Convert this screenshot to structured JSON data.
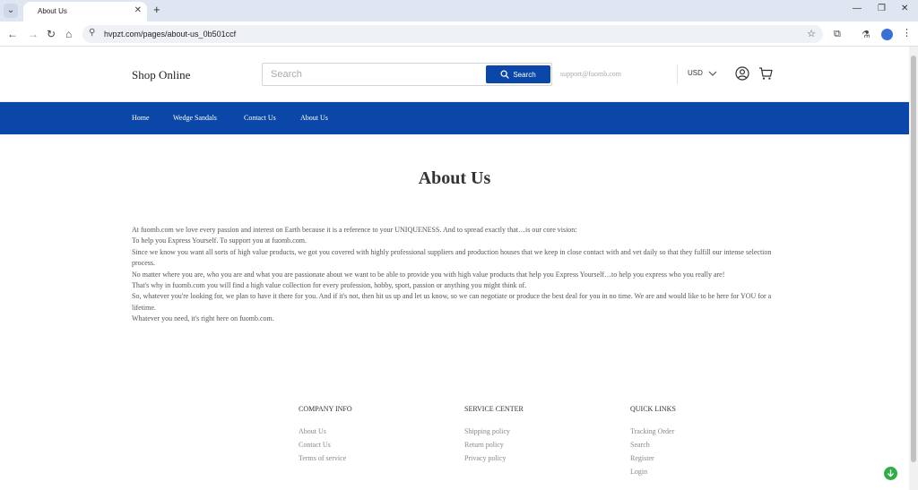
{
  "browser": {
    "tab_title": "About Us",
    "url": "hvpzt.com/pages/about-us_0b501ccf"
  },
  "header": {
    "logo": "Shop Online",
    "search_placeholder": "Search",
    "search_button": "Search",
    "support_email": "support@fuomb.com",
    "currency": "USD"
  },
  "nav": {
    "items": [
      {
        "label": "Home"
      },
      {
        "label": "Wedge Sandals"
      },
      {
        "label": "Contact Us"
      },
      {
        "label": "About Us"
      }
    ]
  },
  "main": {
    "title": "About Us",
    "paragraphs": [
      "At fuomb.com we love every passion and interest on Earth because it is a reference to your UNIQUENESS. And to spread exactly that…is our core vision:",
      "To help you Express Yourself. To support you at fuomb.com.",
      "Since we know you want all sorts of high value products, we got you covered with highly professional suppliers and production houses that we keep in close contact with and vet daily so that they fulfill our intense selection process.",
      "No matter where you are, who you are and what you are passionate about we want to be able to provide you with high value products that help you Express Yourself…to help you express who you really are!",
      "That's why in fuomb.com you will find a high value collection for every profession, hobby, sport, passion or anything you might think of.",
      "So, whatever you're looking for, we plan to have it there for you. And if it's not, then hit us up and let us know, so we can negotiate or produce the best deal for you in no time. We are and would like to be here for YOU for a lifetime.",
      "Whatever you need, it's right here on fuomb.com."
    ]
  },
  "footer": {
    "columns": [
      {
        "title": "COMPANY INFO",
        "links": [
          "About Us",
          "Contact Us",
          "Terms of service"
        ]
      },
      {
        "title": "SERVICE CENTER",
        "links": [
          "Shipping policy",
          "Return policy",
          "Privacy policy"
        ]
      },
      {
        "title": "QUICK LINKS",
        "links": [
          "Tracking Order",
          "Search",
          "Register",
          "Login"
        ]
      }
    ]
  },
  "colors": {
    "brand": "#0a47a8",
    "chat": "#2fae45"
  }
}
